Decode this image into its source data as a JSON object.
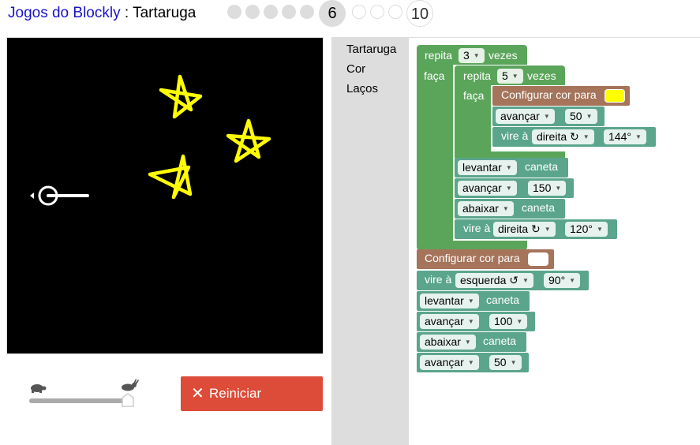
{
  "header": {
    "app_link": "Jogos do Blockly",
    "separator_title": " : Tartaruga",
    "levels_done": 5,
    "current_level": "6",
    "levels_todo": 3,
    "last_level": "10"
  },
  "toolbox": {
    "categories": [
      "Tartaruga",
      "Cor",
      "Laços"
    ]
  },
  "blocks": {
    "repeat_outer": {
      "label1": "repita",
      "count": "3",
      "label2": "vezes",
      "do": "faça"
    },
    "repeat_inner": {
      "label1": "repita",
      "count": "5",
      "label2": "vezes",
      "do": "faça"
    },
    "set_color_1": {
      "label": "Configurar cor para",
      "color": "#ffff00"
    },
    "move_1": {
      "dir": "avançar",
      "value": "50"
    },
    "turn_1": {
      "label": "vire à",
      "dir": "direita ↻",
      "angle": "144°"
    },
    "pen_up_1": {
      "pen": "levantar",
      "label": "caneta"
    },
    "move_2": {
      "dir": "avançar",
      "value": "150"
    },
    "pen_down_1": {
      "pen": "abaixar",
      "label": "caneta"
    },
    "turn_2": {
      "label": "vire à",
      "dir": "direita ↻",
      "angle": "120°"
    },
    "set_color_2": {
      "label": "Configurar cor para",
      "color": "#ffffff"
    },
    "turn_3": {
      "label": "vire à",
      "dir": "esquerda ↺",
      "angle": "90°"
    },
    "pen_up_2": {
      "pen": "levantar",
      "label": "caneta"
    },
    "move_3": {
      "dir": "avançar",
      "value": "100"
    },
    "pen_down_2": {
      "pen": "abaixar",
      "label": "caneta"
    },
    "move_4": {
      "dir": "avançar",
      "value": "50"
    }
  },
  "controls": {
    "reset_label": "Reiniciar"
  },
  "colors": {
    "loop_green": "#5ba55b",
    "turtle_teal": "#5ba58c",
    "color_brown": "#a5745b",
    "reset_red": "#dd4b39",
    "star_yellow": "#ffff00"
  }
}
